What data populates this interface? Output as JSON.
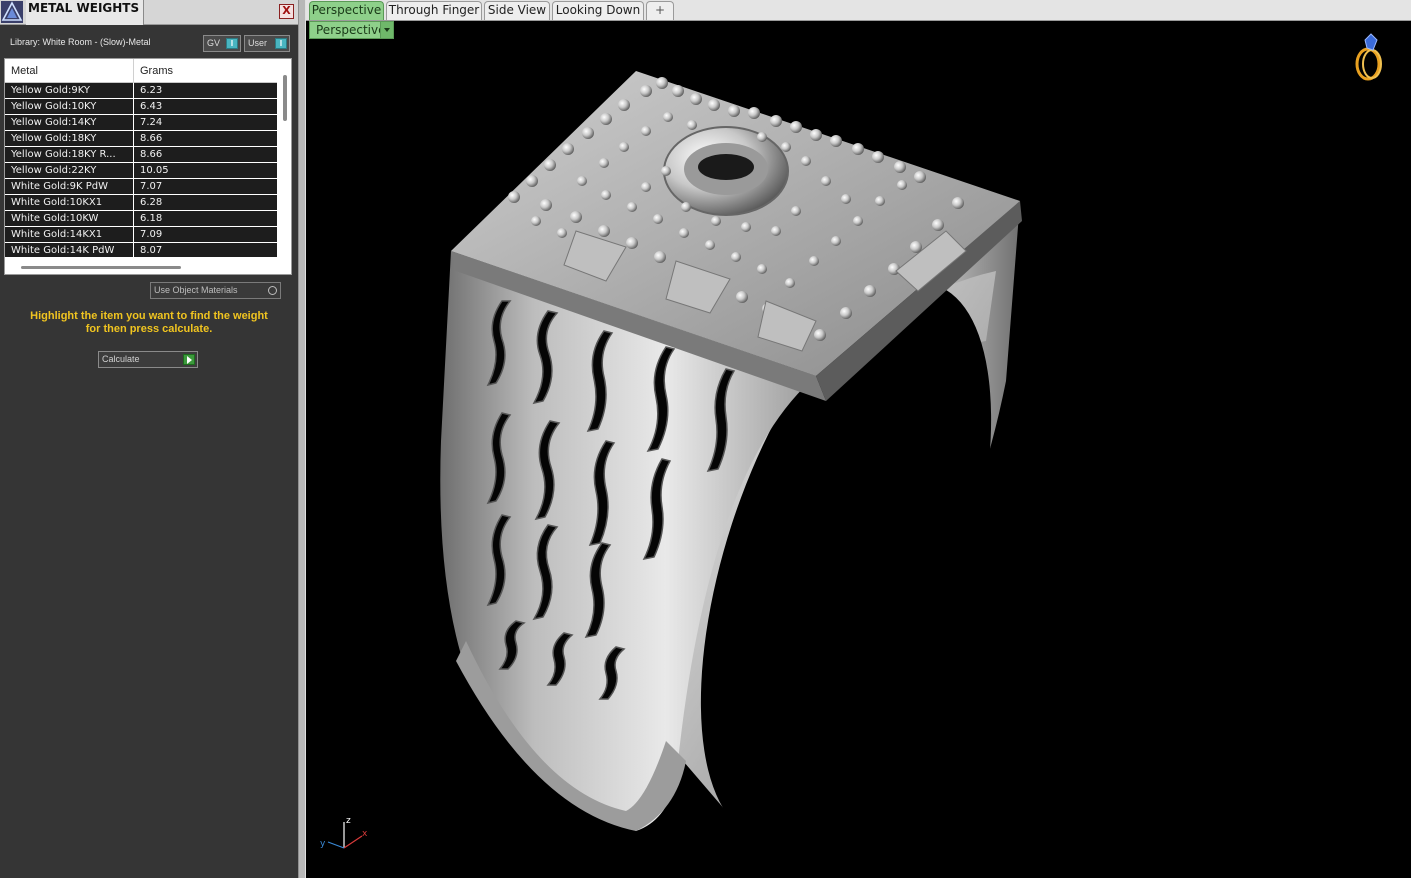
{
  "panel": {
    "title": "METAL WEIGHTS",
    "close_label": "X",
    "library_label": "Library: White Room - (Slow)-Metal",
    "toggles": [
      {
        "label": "GV",
        "knob": "I"
      },
      {
        "label": "User",
        "knob": "I"
      }
    ],
    "table": {
      "columns": [
        "Metal",
        "Grams"
      ],
      "rows": [
        {
          "metal": "Yellow Gold:9KY",
          "grams": "6.23"
        },
        {
          "metal": "Yellow Gold:10KY",
          "grams": "6.43"
        },
        {
          "metal": "Yellow Gold:14KY",
          "grams": "7.24"
        },
        {
          "metal": "Yellow Gold:18KY",
          "grams": "8.66"
        },
        {
          "metal": "Yellow Gold:18KY R...",
          "grams": "8.66"
        },
        {
          "metal": "Yellow Gold:22KY",
          "grams": "10.05"
        },
        {
          "metal": "White Gold:9K PdW",
          "grams": "7.07"
        },
        {
          "metal": "White Gold:10KX1",
          "grams": "6.28"
        },
        {
          "metal": "White Gold:10KW",
          "grams": "6.18"
        },
        {
          "metal": "White Gold:14KX1",
          "grams": "7.09"
        },
        {
          "metal": "White Gold:14K PdW",
          "grams": "8.07"
        }
      ]
    },
    "use_object_materials": "Use Object Materials",
    "hint_lines": [
      "Highlight the item you want to find the weight",
      "for then press calculate."
    ],
    "calculate_label": "Calculate"
  },
  "viewport": {
    "tabs": [
      {
        "label": "Perspective",
        "active": true
      },
      {
        "label": "Through Finger",
        "active": false
      },
      {
        "label": "Side View",
        "active": false
      },
      {
        "label": "Looking Down",
        "active": false
      }
    ],
    "add_tab_label": "+",
    "view_dropdown": "Perspective",
    "axis_labels": {
      "x": "x",
      "y": "y",
      "z": "z"
    }
  },
  "colors": {
    "active_tab": "#8ed08a",
    "hint_text": "#f0c420",
    "viewport_bg": "#000000",
    "row_bg": "#1d1d1d"
  }
}
